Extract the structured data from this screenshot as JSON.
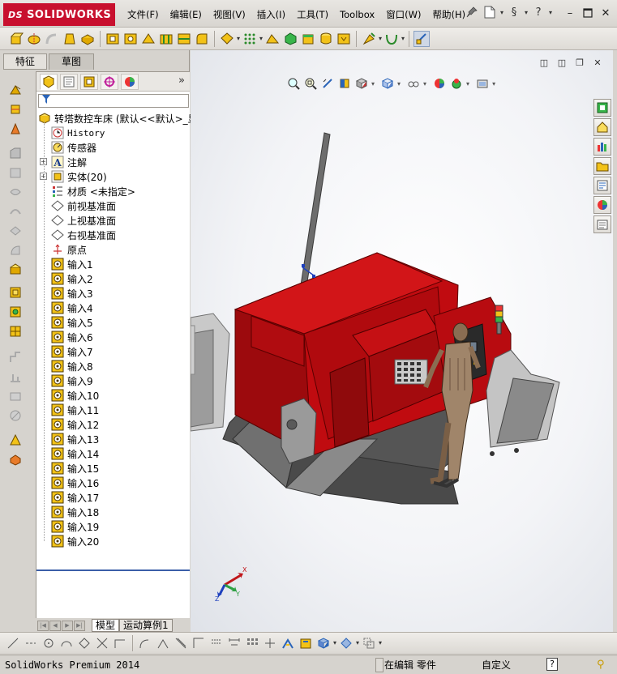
{
  "app": {
    "brand_prefix": "DS",
    "brand": "SOLIDWORKS"
  },
  "menu": [
    "文件(F)",
    "编辑(E)",
    "视图(V)",
    "插入(I)",
    "工具(T)",
    "Toolbox",
    "窗口(W)",
    "帮助(H)"
  ],
  "panel_tabs": {
    "feature": "特征",
    "sketch": "草图"
  },
  "feature_tree": {
    "root": "转塔数控车床  (默认<<默认>_显",
    "history": "History",
    "sensors": "传感器",
    "annotations": "注解",
    "solid_bodies": "实体(20)",
    "material": "材质 <未指定>",
    "front_plane": "前视基准面",
    "top_plane": "上视基准面",
    "right_plane": "右视基准面",
    "origin": "原点",
    "inputs": [
      "输入1",
      "输入2",
      "输入3",
      "输入4",
      "输入5",
      "输入6",
      "输入7",
      "输入8",
      "输入9",
      "输入10",
      "输入11",
      "输入12",
      "输入13",
      "输入14",
      "输入15",
      "输入16",
      "输入17",
      "输入18",
      "输入19",
      "输入20"
    ]
  },
  "bottom_tabs": {
    "model": "模型",
    "motion": "运动算例1"
  },
  "triad": {
    "x": "X",
    "y": "Y",
    "z": "Z"
  },
  "status": {
    "product": "SolidWorks Premium 2014",
    "mode": "在编辑 零件",
    "units": "自定义"
  },
  "colors": {
    "brand_red": "#c8102e",
    "machine_red": "#c00b10",
    "accent_blue": "#3b5fa8"
  },
  "icons": {
    "part": "part-icon",
    "plane": "plane-icon",
    "origin": "origin-icon",
    "import": "import-feature-icon"
  }
}
